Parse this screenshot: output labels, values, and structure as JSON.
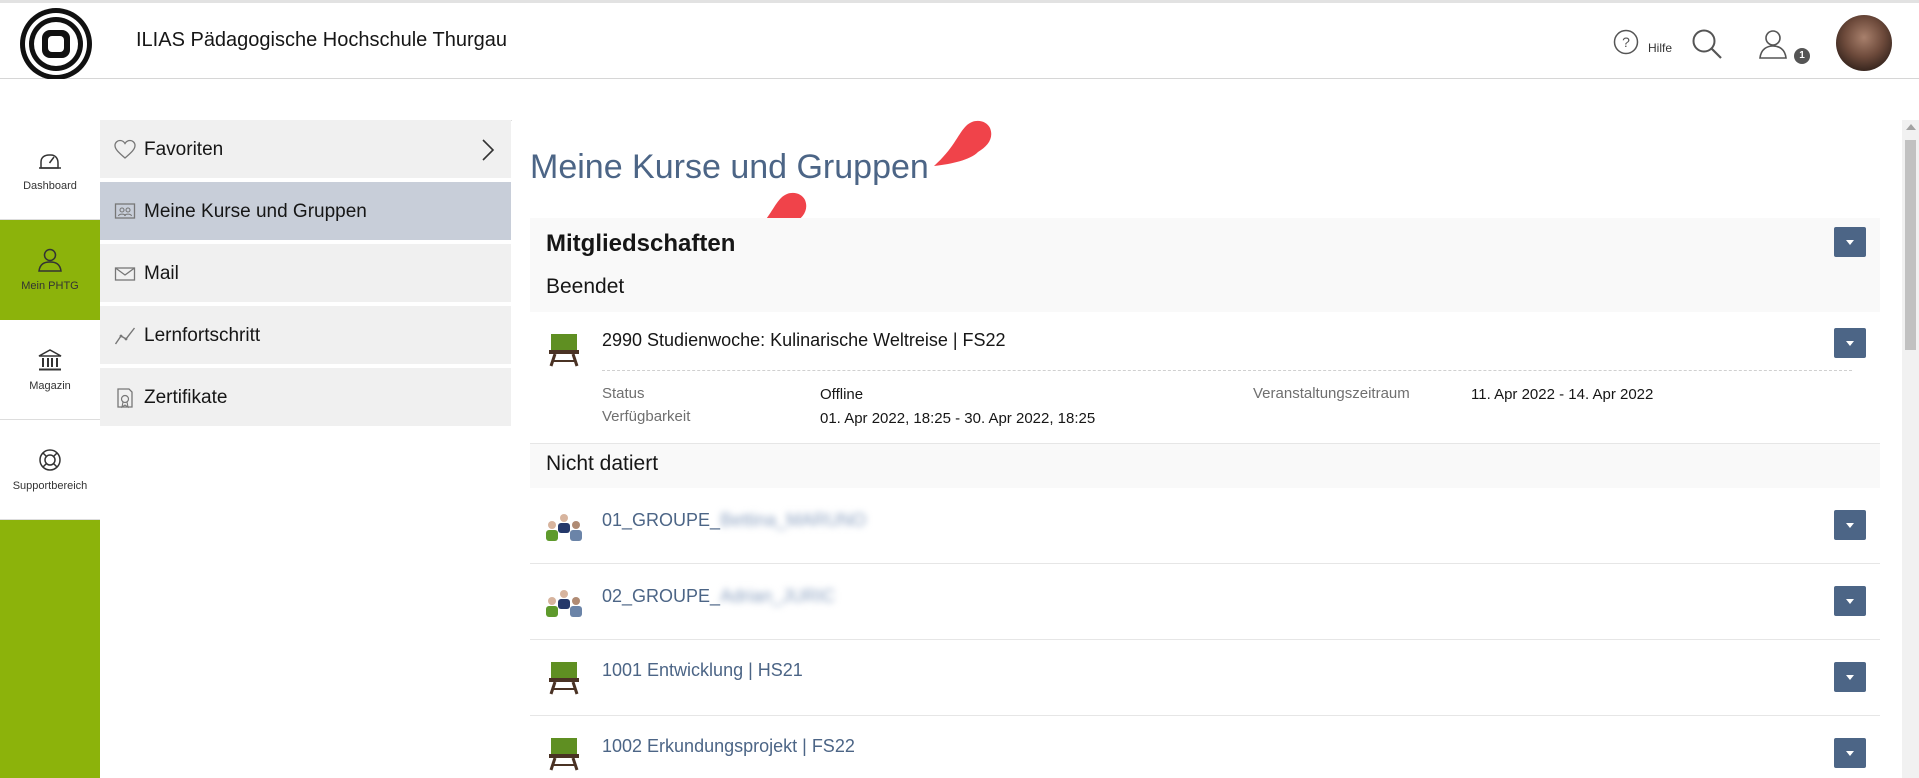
{
  "header": {
    "title": "ILIAS Pädagogische Hochschule Thurgau",
    "help_label": "Hilfe",
    "notification_count": "1"
  },
  "mainbar": {
    "items": [
      {
        "label": "Dashboard",
        "icon": "dashboard-icon"
      },
      {
        "label": "Mein PHTG",
        "icon": "user-icon"
      },
      {
        "label": "Magazin",
        "icon": "repository-icon"
      },
      {
        "label": "Supportbereich",
        "icon": "lifebuoy-icon"
      }
    ]
  },
  "slate": {
    "items": [
      {
        "label": "Favoriten",
        "icon": "heart-icon"
      },
      {
        "label": "Meine Kurse und Gruppen",
        "icon": "courses-icon"
      },
      {
        "label": "Mail",
        "icon": "mail-icon"
      },
      {
        "label": "Lernfortschritt",
        "icon": "progress-icon"
      },
      {
        "label": "Zertifikate",
        "icon": "certificate-icon"
      }
    ]
  },
  "main": {
    "page_title": "Meine Kurse und Gruppen",
    "panel_title": "Mitgliedschaften",
    "groups": {
      "ended": "Beendet",
      "undated": "Nicht datiert"
    },
    "ended_item": {
      "title": "2990 Studienwoche: Kulinarische Weltreise | FS22",
      "status_label": "Status",
      "status_value": "Offline",
      "availability_label": "Verfügbarkeit",
      "availability_value": "01. Apr 2022, 18:25 - 30. Apr 2022, 18:25",
      "period_label": "Veranstaltungszeitraum",
      "period_value": "11. Apr 2022 - 14. Apr 2022"
    },
    "undated_items": [
      {
        "title": "01_GROUPE_",
        "blurred": "Bettina_MARUNO",
        "type": "group"
      },
      {
        "title": "02_GROUPE_",
        "blurred": "Adrian_JURIC",
        "type": "group"
      },
      {
        "title": "1001 Entwicklung | HS21",
        "blurred": "",
        "type": "course"
      },
      {
        "title": "1002 Erkundungsprojekt | FS22",
        "blurred": "",
        "type": "course"
      }
    ]
  },
  "colors": {
    "accent": "#4c6586",
    "mainbar_green": "#8cb30b",
    "marker_red": "#f0434a"
  }
}
